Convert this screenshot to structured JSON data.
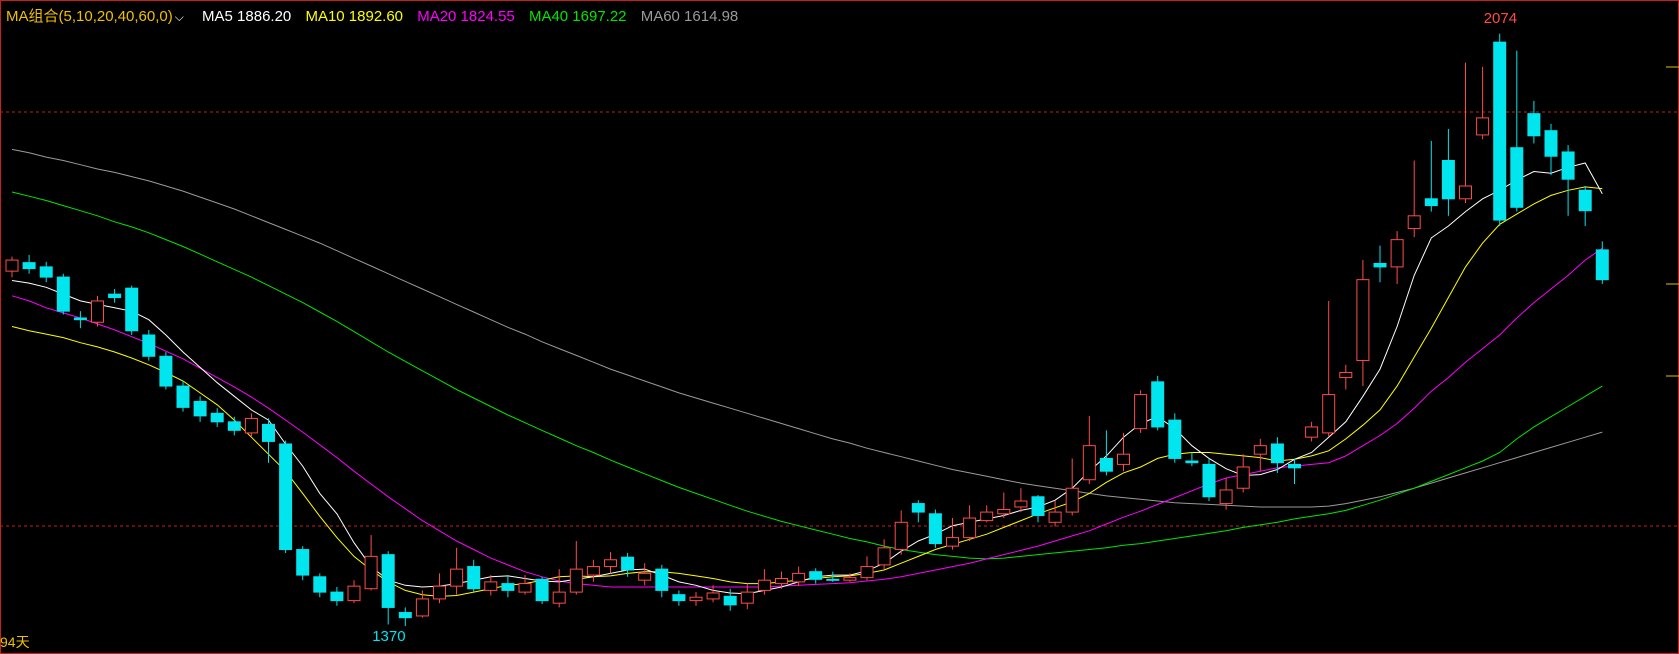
{
  "legend": {
    "title": "MA组合(5,10,20,40,60,0)",
    "chevron": "⌵",
    "ma5": "MA5 1886.20",
    "ma10": "MA10 1892.60",
    "ma20": "MA20 1824.55",
    "ma40": "MA40 1697.22",
    "ma60": "MA60 1614.98"
  },
  "days_label": "94天",
  "colors": {
    "background": "#000000",
    "frame": "#c8201c",
    "up": "#ff4a4a",
    "down": "#00e5ee",
    "ma5": "#ffffff",
    "ma10": "#ffff00",
    "ma20": "#ff00ff",
    "ma40": "#00e600",
    "ma60": "#9a9a9a",
    "title": "#f0c000",
    "peak_label": "#ff4a4a",
    "low_label": "#00e5ee"
  },
  "chart_data": {
    "type": "candlestick",
    "y_range": [
      1350,
      2090
    ],
    "high_label": "2074",
    "low_label": "1370",
    "high_index": 87,
    "low_index": 22,
    "candles": [
      [
        1795,
        1808,
        1812,
        1788
      ],
      [
        1805,
        1798,
        1814,
        1792
      ],
      [
        1800,
        1788,
        1806,
        1782
      ],
      [
        1788,
        1748,
        1792,
        1744
      ],
      [
        1740,
        1738,
        1748,
        1728
      ],
      [
        1735,
        1760,
        1766,
        1730
      ],
      [
        1768,
        1764,
        1774,
        1758
      ],
      [
        1775,
        1725,
        1778,
        1720
      ],
      [
        1720,
        1695,
        1726,
        1690
      ],
      [
        1695,
        1660,
        1700,
        1656
      ],
      [
        1660,
        1635,
        1666,
        1630
      ],
      [
        1642,
        1625,
        1648,
        1618
      ],
      [
        1628,
        1618,
        1634,
        1612
      ],
      [
        1618,
        1608,
        1624,
        1602
      ],
      [
        1605,
        1622,
        1628,
        1600
      ],
      [
        1615,
        1595,
        1622,
        1570
      ],
      [
        1592,
        1468,
        1596,
        1464
      ],
      [
        1468,
        1438,
        1472,
        1432
      ],
      [
        1436,
        1418,
        1440,
        1412
      ],
      [
        1418,
        1408,
        1424,
        1402
      ],
      [
        1408,
        1425,
        1432,
        1405
      ],
      [
        1422,
        1460,
        1485,
        1420
      ],
      [
        1462,
        1400,
        1466,
        1380
      ],
      [
        1394,
        1388,
        1400,
        1378
      ],
      [
        1390,
        1410,
        1420,
        1388
      ],
      [
        1410,
        1425,
        1440,
        1405
      ],
      [
        1425,
        1445,
        1470,
        1415
      ],
      [
        1448,
        1422,
        1456,
        1418
      ],
      [
        1420,
        1430,
        1438,
        1414
      ],
      [
        1428,
        1420,
        1436,
        1412
      ],
      [
        1418,
        1428,
        1438,
        1415
      ],
      [
        1433,
        1408,
        1436,
        1404
      ],
      [
        1405,
        1418,
        1445,
        1400
      ],
      [
        1418,
        1445,
        1478,
        1415
      ],
      [
        1438,
        1448,
        1456,
        1430
      ],
      [
        1448,
        1456,
        1465,
        1440
      ],
      [
        1459,
        1444,
        1464,
        1436
      ],
      [
        1432,
        1440,
        1452,
        1426
      ],
      [
        1445,
        1420,
        1450,
        1412
      ],
      [
        1415,
        1408,
        1420,
        1402
      ],
      [
        1408,
        1412,
        1418,
        1402
      ],
      [
        1410,
        1417,
        1426,
        1406
      ],
      [
        1413,
        1403,
        1422,
        1396
      ],
      [
        1405,
        1418,
        1428,
        1398
      ],
      [
        1420,
        1432,
        1445,
        1415
      ],
      [
        1428,
        1434,
        1442,
        1422
      ],
      [
        1430,
        1440,
        1448,
        1425
      ],
      [
        1442,
        1433,
        1446,
        1428
      ],
      [
        1433,
        1432,
        1442,
        1430
      ],
      [
        1432,
        1435,
        1440,
        1430
      ],
      [
        1435,
        1448,
        1460,
        1432
      ],
      [
        1450,
        1470,
        1480,
        1445
      ],
      [
        1468,
        1500,
        1514,
        1462
      ],
      [
        1522,
        1512,
        1526,
        1500
      ],
      [
        1510,
        1475,
        1515,
        1470
      ],
      [
        1472,
        1482,
        1505,
        1468
      ],
      [
        1482,
        1505,
        1520,
        1478
      ],
      [
        1502,
        1512,
        1520,
        1500
      ],
      [
        1510,
        1515,
        1535,
        1505
      ],
      [
        1518,
        1525,
        1540,
        1512
      ],
      [
        1530,
        1508,
        1532,
        1500
      ],
      [
        1500,
        1512,
        1525,
        1495
      ],
      [
        1512,
        1540,
        1575,
        1508
      ],
      [
        1550,
        1590,
        1625,
        1545
      ],
      [
        1575,
        1560,
        1608,
        1555
      ],
      [
        1568,
        1580,
        1605,
        1560
      ],
      [
        1610,
        1650,
        1655,
        1605
      ],
      [
        1665,
        1612,
        1672,
        1608
      ],
      [
        1620,
        1575,
        1628,
        1570
      ],
      [
        1572,
        1570,
        1582,
        1566
      ],
      [
        1568,
        1530,
        1574,
        1525
      ],
      [
        1522,
        1538,
        1552,
        1515
      ],
      [
        1540,
        1565,
        1580,
        1535
      ],
      [
        1580,
        1590,
        1598,
        1560
      ],
      [
        1592,
        1570,
        1600,
        1558
      ],
      [
        1568,
        1564,
        1575,
        1545
      ],
      [
        1600,
        1612,
        1618,
        1595
      ],
      [
        1605,
        1650,
        1760,
        1600
      ],
      [
        1670,
        1676,
        1685,
        1656
      ],
      [
        1690,
        1785,
        1808,
        1660
      ],
      [
        1804,
        1800,
        1825,
        1782
      ],
      [
        1800,
        1832,
        1842,
        1780
      ],
      [
        1845,
        1860,
        1925,
        1835
      ],
      [
        1880,
        1872,
        1948,
        1865
      ],
      [
        1925,
        1880,
        1962,
        1860
      ],
      [
        1880,
        1895,
        2040,
        1875
      ],
      [
        1955,
        1975,
        2035,
        1950
      ],
      [
        2064,
        1855,
        2074,
        1848
      ],
      [
        1940,
        1870,
        2054,
        1865
      ],
      [
        1980,
        1954,
        1995,
        1945
      ],
      [
        1960,
        1930,
        1968,
        1908
      ],
      [
        1935,
        1903,
        1943,
        1860
      ],
      [
        1890,
        1866,
        1895,
        1848
      ],
      [
        1820,
        1785,
        1830,
        1780
      ]
    ],
    "ma5": [
      1784,
      1781,
      1776,
      1768,
      1760,
      1756,
      1752,
      1748,
      1738,
      1720,
      1700,
      1682,
      1664,
      1648,
      1632,
      1620,
      1592,
      1566,
      1534,
      1510,
      1476,
      1448,
      1432,
      1426,
      1424,
      1425,
      1428,
      1432,
      1436,
      1437,
      1434,
      1431,
      1430,
      1433,
      1436,
      1440,
      1444,
      1445,
      1438,
      1430,
      1426,
      1420,
      1417,
      1416,
      1420,
      1424,
      1430,
      1436,
      1438,
      1438,
      1443,
      1452,
      1466,
      1478,
      1486,
      1496,
      1500,
      1504,
      1508,
      1514,
      1518,
      1526,
      1540,
      1560,
      1578,
      1600,
      1616,
      1624,
      1610,
      1590,
      1575,
      1563,
      1555,
      1556,
      1562,
      1574,
      1582,
      1600,
      1618,
      1648,
      1680,
      1730,
      1790,
      1834,
      1848,
      1865,
      1880,
      1890,
      1902,
      1912,
      1910,
      1917,
      1922,
      1886
    ],
    "ma10": [
      1730,
      1725,
      1721,
      1717,
      1711,
      1706,
      1700,
      1693,
      1685,
      1676,
      1666,
      1652,
      1638,
      1620,
      1600,
      1580,
      1560,
      1534,
      1507,
      1482,
      1460,
      1444,
      1430,
      1420,
      1415,
      1413,
      1414,
      1418,
      1422,
      1426,
      1428,
      1432,
      1436,
      1437,
      1436,
      1437,
      1440,
      1442,
      1442,
      1440,
      1437,
      1434,
      1430,
      1428,
      1428,
      1430,
      1432,
      1434,
      1436,
      1437,
      1440,
      1444,
      1452,
      1460,
      1468,
      1474,
      1480,
      1486,
      1494,
      1502,
      1510,
      1517,
      1524,
      1534,
      1547,
      1558,
      1565,
      1575,
      1580,
      1582,
      1582,
      1580,
      1578,
      1576,
      1572,
      1574,
      1578,
      1584,
      1598,
      1614,
      1632,
      1660,
      1694,
      1728,
      1764,
      1800,
      1828,
      1850,
      1862,
      1874,
      1884,
      1890,
      1894,
      1892
    ],
    "ma20": [
      1766,
      1760,
      1752,
      1746,
      1740,
      1733,
      1726,
      1718,
      1710,
      1701,
      1692,
      1681,
      1670,
      1659,
      1647,
      1634,
      1620,
      1606,
      1591,
      1576,
      1560,
      1545,
      1530,
      1516,
      1502,
      1490,
      1478,
      1468,
      1458,
      1450,
      1442,
      1436,
      1431,
      1428,
      1426,
      1424,
      1424,
      1424,
      1424,
      1424,
      1424,
      1424,
      1424,
      1424,
      1424,
      1425,
      1426,
      1427,
      1428,
      1429,
      1431,
      1433,
      1436,
      1440,
      1444,
      1448,
      1452,
      1457,
      1462,
      1467,
      1472,
      1478,
      1484,
      1490,
      1498,
      1506,
      1513,
      1521,
      1529,
      1537,
      1545,
      1552,
      1556,
      1560,
      1564,
      1566,
      1568,
      1570,
      1578,
      1590,
      1602,
      1616,
      1634,
      1654,
      1670,
      1688,
      1704,
      1720,
      1740,
      1758,
      1774,
      1790,
      1808,
      1822
    ],
    "ma40": [
      1888,
      1883,
      1878,
      1872,
      1866,
      1860,
      1853,
      1847,
      1840,
      1832,
      1824,
      1815,
      1806,
      1797,
      1788,
      1778,
      1768,
      1758,
      1747,
      1736,
      1724,
      1712,
      1700,
      1689,
      1678,
      1667,
      1656,
      1646,
      1636,
      1626,
      1617,
      1608,
      1599,
      1590,
      1582,
      1573,
      1565,
      1557,
      1549,
      1541,
      1534,
      1527,
      1520,
      1513,
      1507,
      1501,
      1496,
      1491,
      1486,
      1481,
      1477,
      1472,
      1468,
      1465,
      1462,
      1460,
      1458,
      1457,
      1458,
      1460,
      1462,
      1464,
      1466,
      1468,
      1470,
      1473,
      1475,
      1478,
      1481,
      1484,
      1487,
      1490,
      1494,
      1497,
      1500,
      1504,
      1507,
      1510,
      1514,
      1520,
      1526,
      1533,
      1540,
      1548,
      1556,
      1564,
      1572,
      1582,
      1598,
      1612,
      1624,
      1636,
      1648,
      1660
    ],
    "ma60": [
      1938,
      1934,
      1929,
      1925,
      1920,
      1915,
      1911,
      1906,
      1901,
      1895,
      1889,
      1882,
      1875,
      1868,
      1860,
      1852,
      1844,
      1836,
      1828,
      1819,
      1810,
      1801,
      1792,
      1783,
      1774,
      1765,
      1756,
      1747,
      1738,
      1729,
      1721,
      1712,
      1704,
      1696,
      1688,
      1680,
      1673,
      1666,
      1659,
      1652,
      1646,
      1640,
      1634,
      1628,
      1622,
      1616,
      1610,
      1604,
      1598,
      1593,
      1587,
      1582,
      1577,
      1572,
      1567,
      1562,
      1558,
      1554,
      1550,
      1546,
      1543,
      1540,
      1537,
      1534,
      1531,
      1529,
      1527,
      1525,
      1523,
      1522,
      1521,
      1520,
      1519,
      1518,
      1518,
      1518,
      1518,
      1519,
      1522,
      1526,
      1530,
      1535,
      1540,
      1546,
      1552,
      1558,
      1564,
      1570,
      1576,
      1582,
      1588,
      1594,
      1600,
      1606
    ]
  }
}
